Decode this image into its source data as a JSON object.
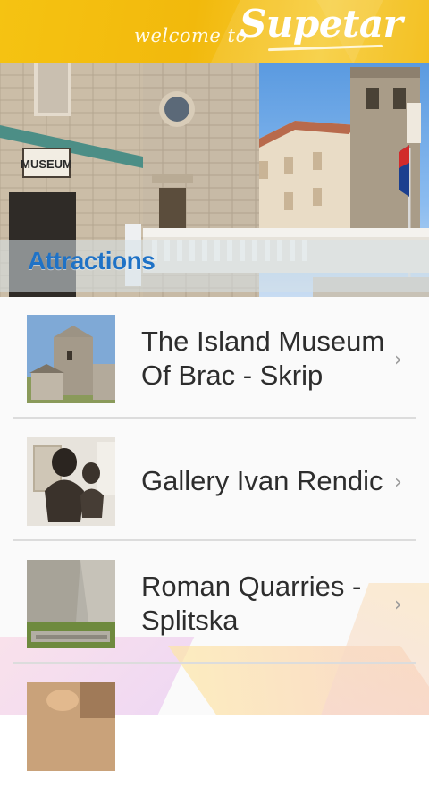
{
  "header": {
    "welcome_text": "welcome to",
    "brand": "Supetar",
    "bg_color": "#f5c312"
  },
  "banner": {
    "museum_sign": "MUSEUM",
    "section_title": "Attractions",
    "title_color": "#1f72c6"
  },
  "attractions": [
    {
      "name": "The Island Museum Of Brac - Skrip",
      "thumb_icon": "stone-tower-photo"
    },
    {
      "name": "Gallery Ivan Rendic",
      "thumb_icon": "bronze-bust-photo"
    },
    {
      "name": "Roman Quarries - Splitska",
      "thumb_icon": "quarry-rock-photo"
    },
    {
      "name": "",
      "thumb_icon": "partial-photo"
    }
  ],
  "chevron_glyph": "›"
}
